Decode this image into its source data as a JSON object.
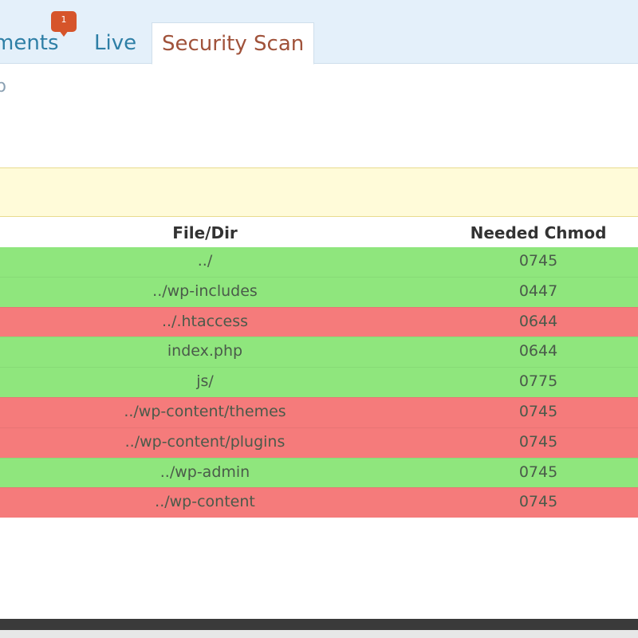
{
  "tabs": {
    "comments": {
      "label": "ments",
      "badge": "1"
    },
    "live": {
      "label": "Live"
    },
    "security": {
      "label": "Security Scan"
    }
  },
  "subtitle": "p",
  "table": {
    "headers": {
      "file": "File/Dir",
      "chmod": "Needed Chmod"
    },
    "rows": [
      {
        "file": "../",
        "chmod": "0745",
        "status": "ok"
      },
      {
        "file": "../wp-includes",
        "chmod": "0447",
        "status": "ok"
      },
      {
        "file": "../.htaccess",
        "chmod": "0644",
        "status": "bad"
      },
      {
        "file": "index.php",
        "chmod": "0644",
        "status": "ok"
      },
      {
        "file": "js/",
        "chmod": "0775",
        "status": "ok"
      },
      {
        "file": "../wp-content/themes",
        "chmod": "0745",
        "status": "bad"
      },
      {
        "file": "../wp-content/plugins",
        "chmod": "0745",
        "status": "bad"
      },
      {
        "file": "../wp-admin",
        "chmod": "0745",
        "status": "ok"
      },
      {
        "file": "../wp-content",
        "chmod": "0745",
        "status": "bad"
      }
    ]
  },
  "colors": {
    "ok": "#8fe67d",
    "bad": "#f57b7b",
    "tab_active": "#a0523a",
    "tab_inactive": "#2e7fa6",
    "badge": "#d6542a"
  }
}
